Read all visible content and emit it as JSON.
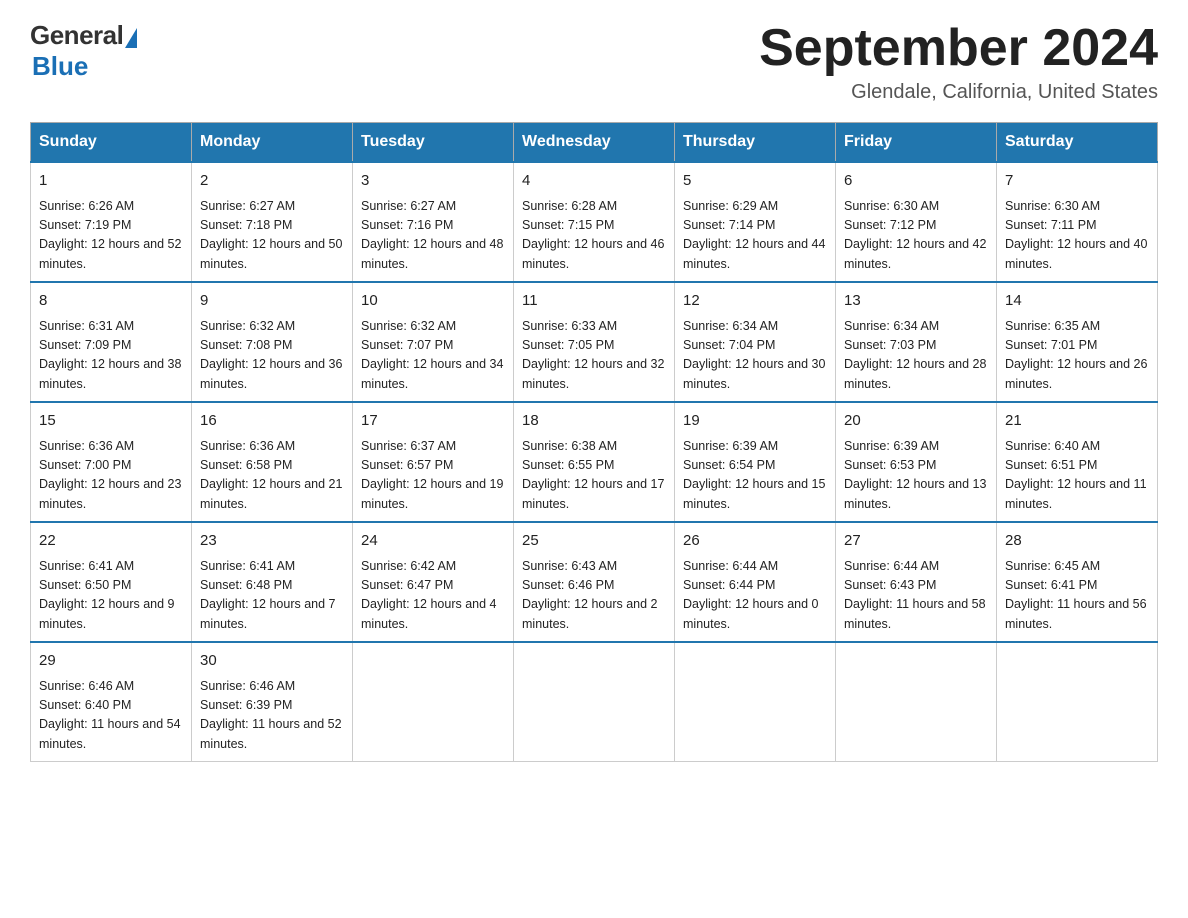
{
  "header": {
    "title": "September 2024",
    "subtitle": "Glendale, California, United States",
    "logo_general": "General",
    "logo_blue": "Blue"
  },
  "days_of_week": [
    "Sunday",
    "Monday",
    "Tuesday",
    "Wednesday",
    "Thursday",
    "Friday",
    "Saturday"
  ],
  "weeks": [
    [
      {
        "day": 1,
        "sunrise": "6:26 AM",
        "sunset": "7:19 PM",
        "daylight": "12 hours and 52 minutes."
      },
      {
        "day": 2,
        "sunrise": "6:27 AM",
        "sunset": "7:18 PM",
        "daylight": "12 hours and 50 minutes."
      },
      {
        "day": 3,
        "sunrise": "6:27 AM",
        "sunset": "7:16 PM",
        "daylight": "12 hours and 48 minutes."
      },
      {
        "day": 4,
        "sunrise": "6:28 AM",
        "sunset": "7:15 PM",
        "daylight": "12 hours and 46 minutes."
      },
      {
        "day": 5,
        "sunrise": "6:29 AM",
        "sunset": "7:14 PM",
        "daylight": "12 hours and 44 minutes."
      },
      {
        "day": 6,
        "sunrise": "6:30 AM",
        "sunset": "7:12 PM",
        "daylight": "12 hours and 42 minutes."
      },
      {
        "day": 7,
        "sunrise": "6:30 AM",
        "sunset": "7:11 PM",
        "daylight": "12 hours and 40 minutes."
      }
    ],
    [
      {
        "day": 8,
        "sunrise": "6:31 AM",
        "sunset": "7:09 PM",
        "daylight": "12 hours and 38 minutes."
      },
      {
        "day": 9,
        "sunrise": "6:32 AM",
        "sunset": "7:08 PM",
        "daylight": "12 hours and 36 minutes."
      },
      {
        "day": 10,
        "sunrise": "6:32 AM",
        "sunset": "7:07 PM",
        "daylight": "12 hours and 34 minutes."
      },
      {
        "day": 11,
        "sunrise": "6:33 AM",
        "sunset": "7:05 PM",
        "daylight": "12 hours and 32 minutes."
      },
      {
        "day": 12,
        "sunrise": "6:34 AM",
        "sunset": "7:04 PM",
        "daylight": "12 hours and 30 minutes."
      },
      {
        "day": 13,
        "sunrise": "6:34 AM",
        "sunset": "7:03 PM",
        "daylight": "12 hours and 28 minutes."
      },
      {
        "day": 14,
        "sunrise": "6:35 AM",
        "sunset": "7:01 PM",
        "daylight": "12 hours and 26 minutes."
      }
    ],
    [
      {
        "day": 15,
        "sunrise": "6:36 AM",
        "sunset": "7:00 PM",
        "daylight": "12 hours and 23 minutes."
      },
      {
        "day": 16,
        "sunrise": "6:36 AM",
        "sunset": "6:58 PM",
        "daylight": "12 hours and 21 minutes."
      },
      {
        "day": 17,
        "sunrise": "6:37 AM",
        "sunset": "6:57 PM",
        "daylight": "12 hours and 19 minutes."
      },
      {
        "day": 18,
        "sunrise": "6:38 AM",
        "sunset": "6:55 PM",
        "daylight": "12 hours and 17 minutes."
      },
      {
        "day": 19,
        "sunrise": "6:39 AM",
        "sunset": "6:54 PM",
        "daylight": "12 hours and 15 minutes."
      },
      {
        "day": 20,
        "sunrise": "6:39 AM",
        "sunset": "6:53 PM",
        "daylight": "12 hours and 13 minutes."
      },
      {
        "day": 21,
        "sunrise": "6:40 AM",
        "sunset": "6:51 PM",
        "daylight": "12 hours and 11 minutes."
      }
    ],
    [
      {
        "day": 22,
        "sunrise": "6:41 AM",
        "sunset": "6:50 PM",
        "daylight": "12 hours and 9 minutes."
      },
      {
        "day": 23,
        "sunrise": "6:41 AM",
        "sunset": "6:48 PM",
        "daylight": "12 hours and 7 minutes."
      },
      {
        "day": 24,
        "sunrise": "6:42 AM",
        "sunset": "6:47 PM",
        "daylight": "12 hours and 4 minutes."
      },
      {
        "day": 25,
        "sunrise": "6:43 AM",
        "sunset": "6:46 PM",
        "daylight": "12 hours and 2 minutes."
      },
      {
        "day": 26,
        "sunrise": "6:44 AM",
        "sunset": "6:44 PM",
        "daylight": "12 hours and 0 minutes."
      },
      {
        "day": 27,
        "sunrise": "6:44 AM",
        "sunset": "6:43 PM",
        "daylight": "11 hours and 58 minutes."
      },
      {
        "day": 28,
        "sunrise": "6:45 AM",
        "sunset": "6:41 PM",
        "daylight": "11 hours and 56 minutes."
      }
    ],
    [
      {
        "day": 29,
        "sunrise": "6:46 AM",
        "sunset": "6:40 PM",
        "daylight": "11 hours and 54 minutes."
      },
      {
        "day": 30,
        "sunrise": "6:46 AM",
        "sunset": "6:39 PM",
        "daylight": "11 hours and 52 minutes."
      },
      null,
      null,
      null,
      null,
      null
    ]
  ],
  "labels": {
    "sunrise": "Sunrise:",
    "sunset": "Sunset:",
    "daylight": "Daylight:"
  }
}
